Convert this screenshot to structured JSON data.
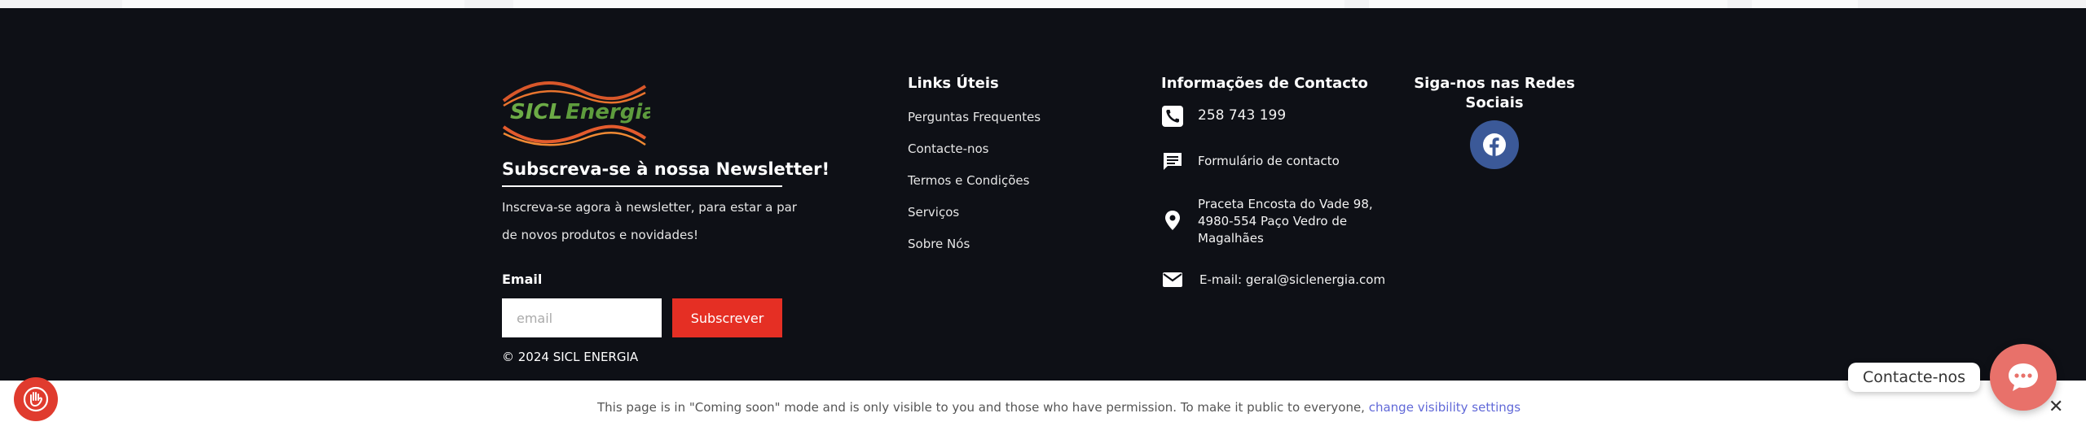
{
  "brand": {
    "logo_text": "SICL Energia"
  },
  "newsletter": {
    "title": "Subscreva-se à nossa Newsletter!",
    "description": "Inscreva-se agora à newsletter, para estar a par de novos produtos e novidades!",
    "email_label": "Email",
    "email_placeholder": "email",
    "email_value": "",
    "subscribe_label": "Subscrever"
  },
  "copyright": "© 2024 SICL ENERGIA",
  "links": {
    "title": "Links Úteis",
    "items": [
      "Perguntas Frequentes",
      "Contacte-nos",
      "Termos e Condições",
      "Serviços",
      "Sobre Nós"
    ]
  },
  "contact": {
    "title": "Informações de Contacto",
    "phone": "258 743 199",
    "form": "Formulário de contacto",
    "address": "Praceta Encosta do Vade 98, 4980-554 Paço Vedro de Magalhães",
    "email": "E-mail: geral@siclenergia.com",
    "icons": [
      "phone-icon",
      "message-icon",
      "location-pin-icon",
      "mail-icon"
    ]
  },
  "social": {
    "title": "Siga-nos nas Redes Sociais",
    "items": [
      {
        "icon": "facebook-icon",
        "color": "#3b5998"
      }
    ]
  },
  "coming_soon": {
    "message": "This page is in \"Coming soon\" mode and is only visible to you and those who have permission. To make it public to everyone,",
    "link_text": "change visibility settings",
    "close_symbol": "✕"
  },
  "chat": {
    "label": "Contacte-nos"
  },
  "colors": {
    "footer_bg": "#0e1016",
    "accent_red": "#e52f24",
    "facebook": "#3b5998",
    "chat_button": "#e8716a",
    "link_blue": "#6169d8"
  }
}
